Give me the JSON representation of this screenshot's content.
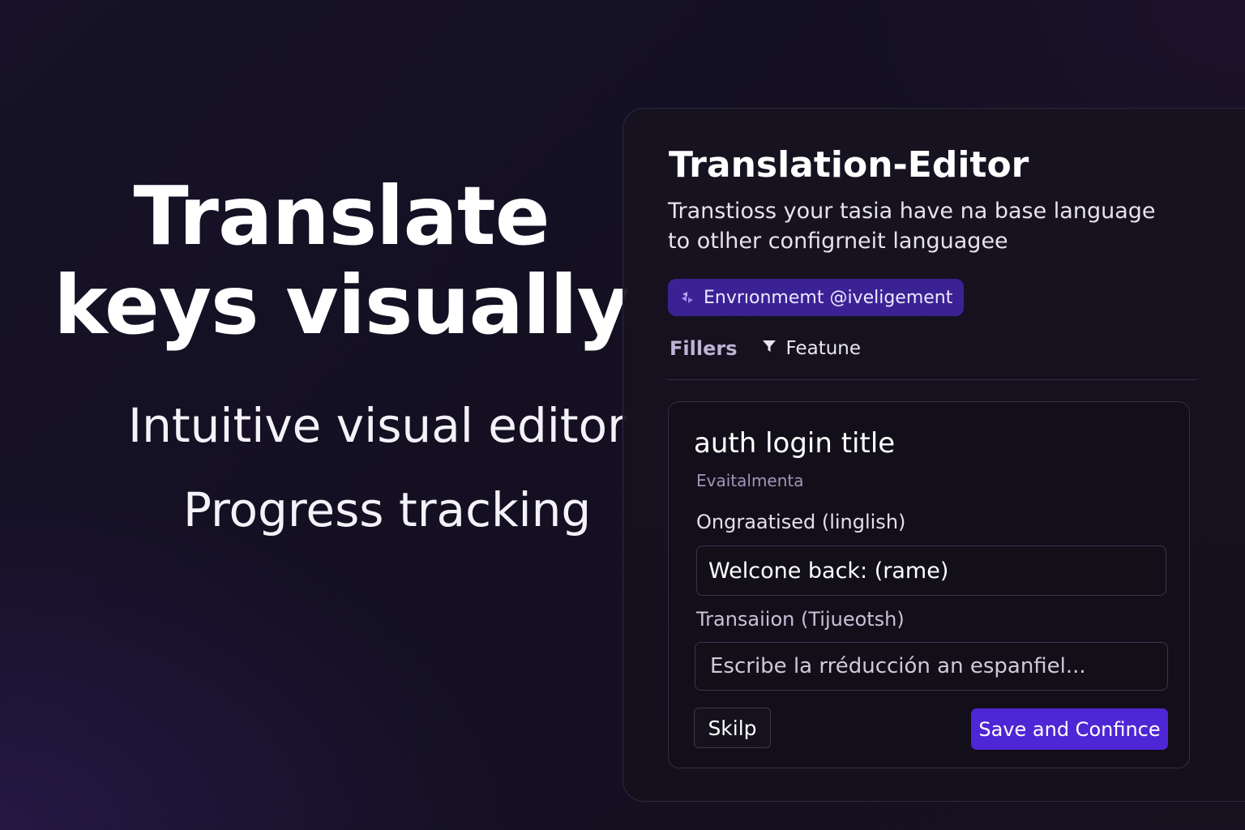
{
  "hero": {
    "title_line1": "Translate",
    "title_line2": "keys visually",
    "feature1": "Intuitive visual editor",
    "feature2": "Progress tracking"
  },
  "editor": {
    "title": "Translation-Editor",
    "description": "Transtioss your tasia have na base language to otlher configrneit languagee",
    "environment_badge": {
      "icon": "environment-icon",
      "label": "Envrıonmemt @iveligement"
    },
    "filters": {
      "label": "Fillers",
      "feature_icon": "filter-icon",
      "feature_label": "Featune"
    },
    "key_card": {
      "key_name": "auth login title",
      "tag": "Evaitalmenta",
      "original_label": "Ongraatised (linglish)",
      "original_value": "Welcone back: (rame)",
      "translation_label": "Transaiion (Tijueotsh)",
      "translation_placeholder": "Escribe la rréducción an espanfiel...",
      "translation_value": "",
      "skip_label": "Skilp",
      "save_label": "Save and Confince"
    }
  },
  "colors": {
    "accent": "#4f26d6",
    "badge": "#3b2294",
    "background": "#151123"
  }
}
